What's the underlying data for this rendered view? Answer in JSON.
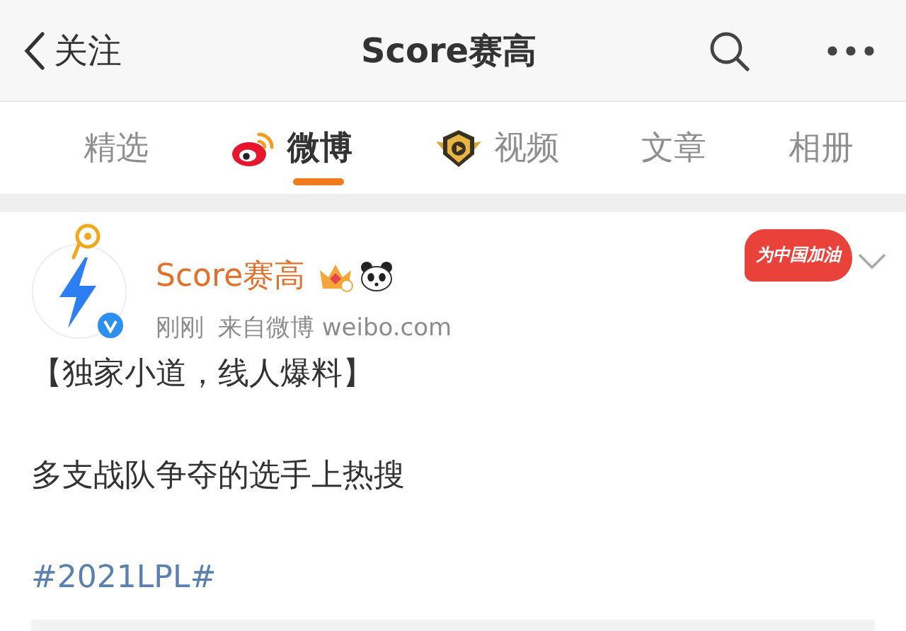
{
  "header": {
    "back_label": "关注",
    "title": "Score赛高"
  },
  "tabs": [
    {
      "label": "精选",
      "selected": false,
      "kind": "plain"
    },
    {
      "label": "微博",
      "selected": true,
      "kind": "weibo"
    },
    {
      "label": "视频",
      "selected": false,
      "kind": "video"
    },
    {
      "label": "文章",
      "selected": false,
      "kind": "plain"
    },
    {
      "label": "相册",
      "selected": false,
      "kind": "plain"
    }
  ],
  "post": {
    "author": "Score赛高",
    "verified": true,
    "time": "刚刚",
    "source": "来自微博 weibo.com",
    "badge": "为中国加油",
    "paragraphs": [
      {
        "kind": "text",
        "text": "【独家小道，线人爆料】"
      },
      {
        "kind": "text",
        "text": "多支战队争夺的选手上热搜"
      },
      {
        "kind": "hashtag",
        "text": "#2021LPL#"
      }
    ]
  }
}
